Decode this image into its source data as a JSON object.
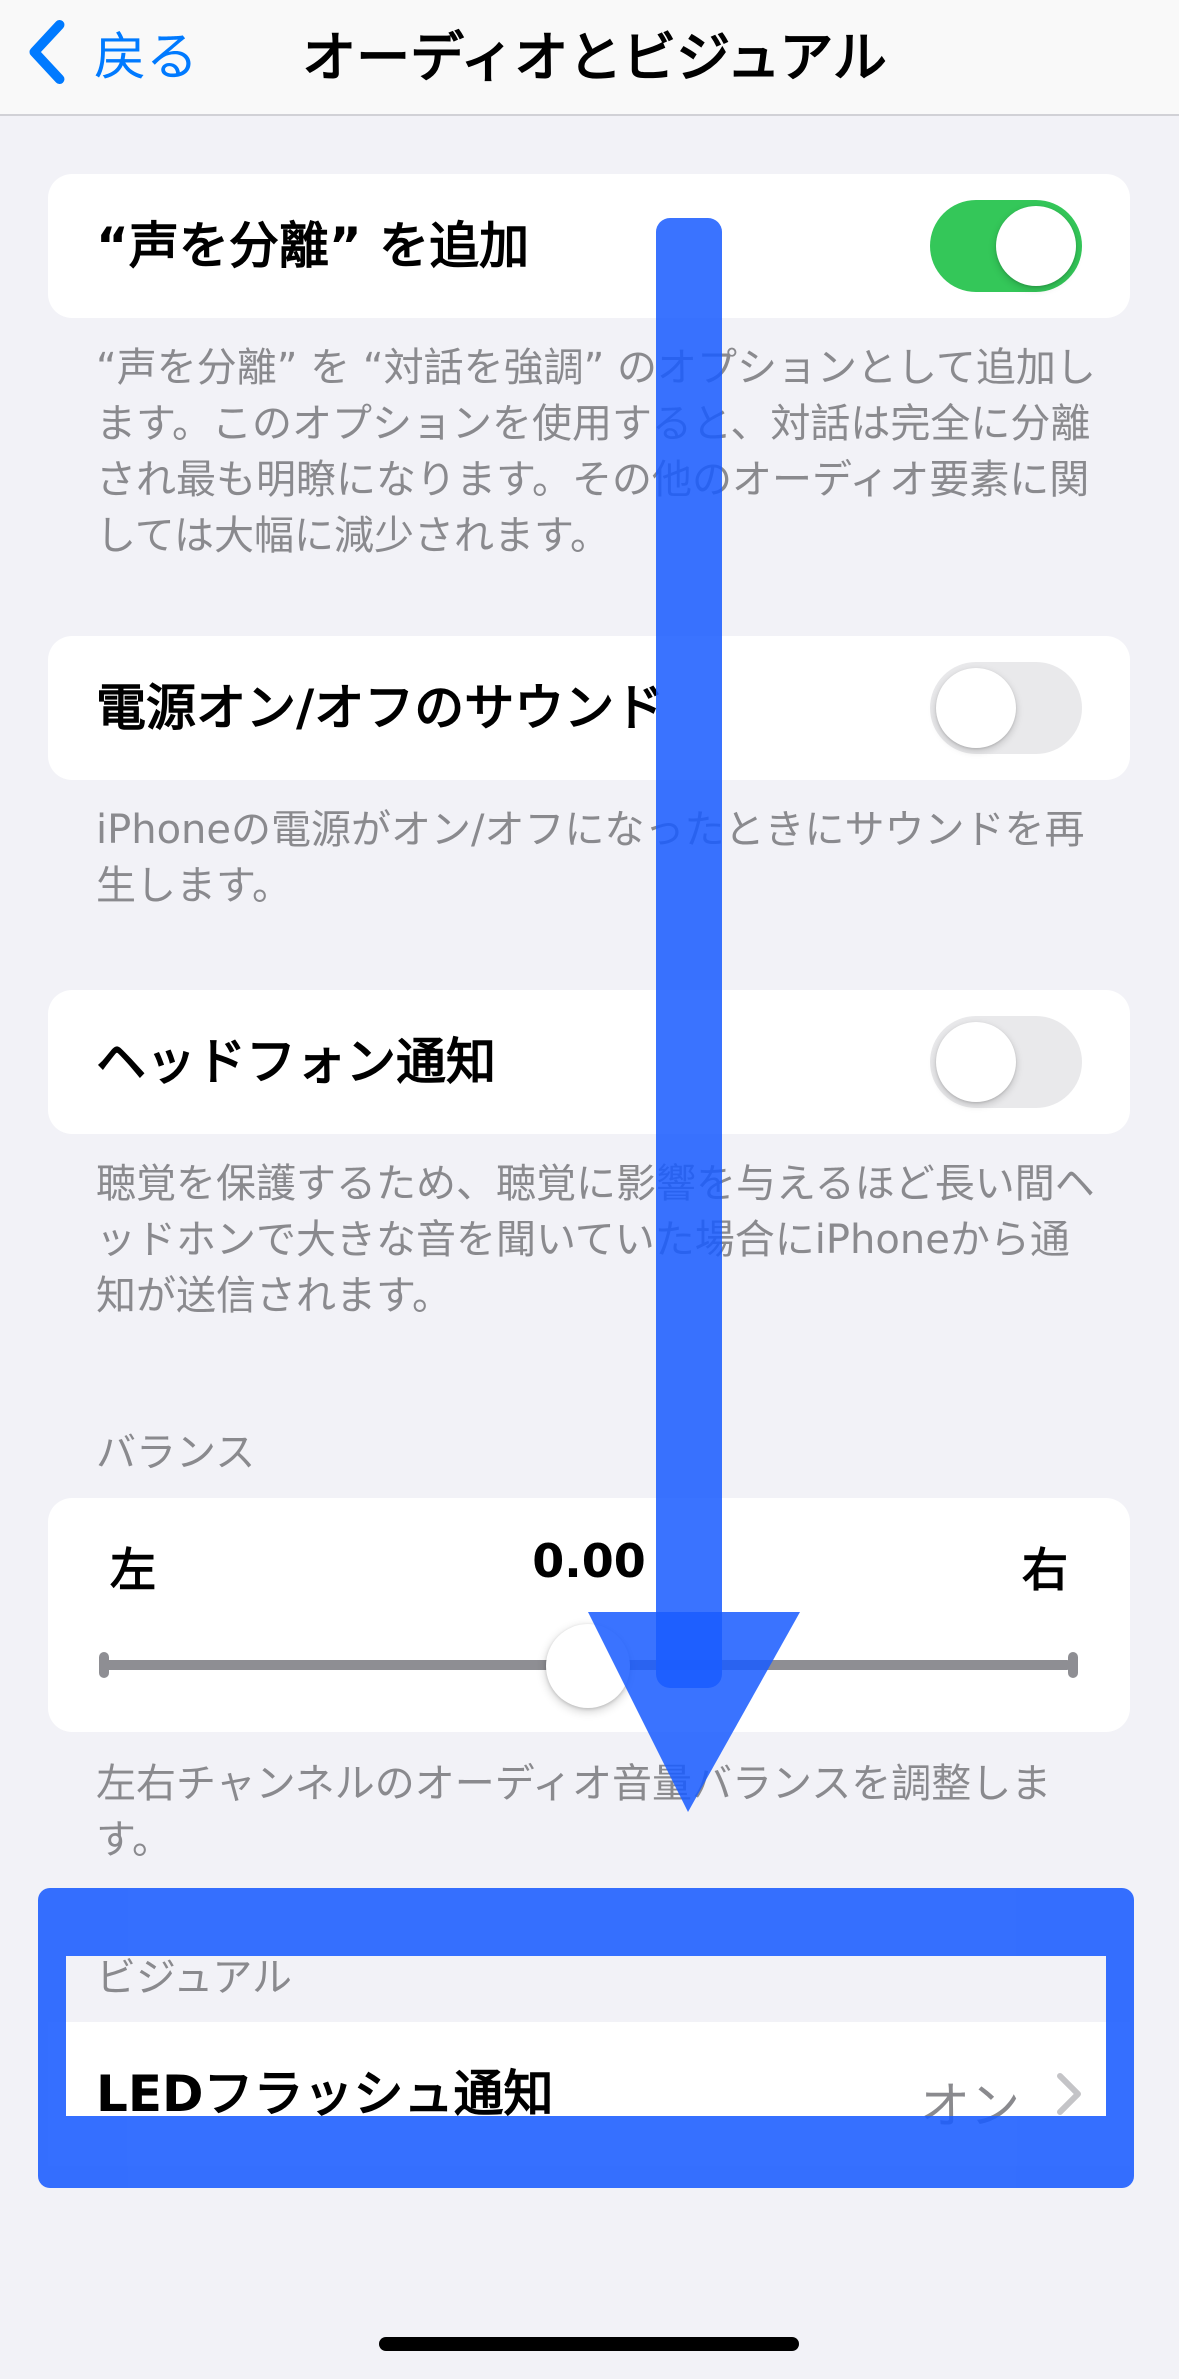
{
  "nav": {
    "back_label": "戻る",
    "title": "オーディオとビジュアル"
  },
  "voice_isolation": {
    "label": "“声を分離” を追加",
    "enabled": true,
    "footnote": "“声を分離” を “対話を強調” のオプションとして追加します。このオプションを使用すると、対話は完全に分離され最も明瞭になります。その他のオーディオ要素に関しては大幅に減少されます。"
  },
  "power_sounds": {
    "label": "電源オン/オフのサウンド",
    "enabled": false,
    "footnote": "iPhoneの電源がオン/オフになったときにサウンドを再生します。"
  },
  "headphone_notifications": {
    "label": "ヘッドフォン通知",
    "enabled": false,
    "footnote": "聴覚を保護するため、聴覚に影響を与えるほど長い間ヘッドホンで大きな音を聞いていた場合にiPhoneから通知が送信されます。"
  },
  "balance": {
    "header": "バランス",
    "left_label": "左",
    "right_label": "右",
    "value": "0.00",
    "footnote": "左右チャンネルのオーディオ音量バランスを調整します。"
  },
  "visual": {
    "header": "ビジュアル",
    "led_flash_label": "LEDフラッシュ通知",
    "led_flash_value": "オン"
  },
  "colors": {
    "accent": "#007aff",
    "toggle_on": "#34c759",
    "annotation": "#1a5cff"
  }
}
